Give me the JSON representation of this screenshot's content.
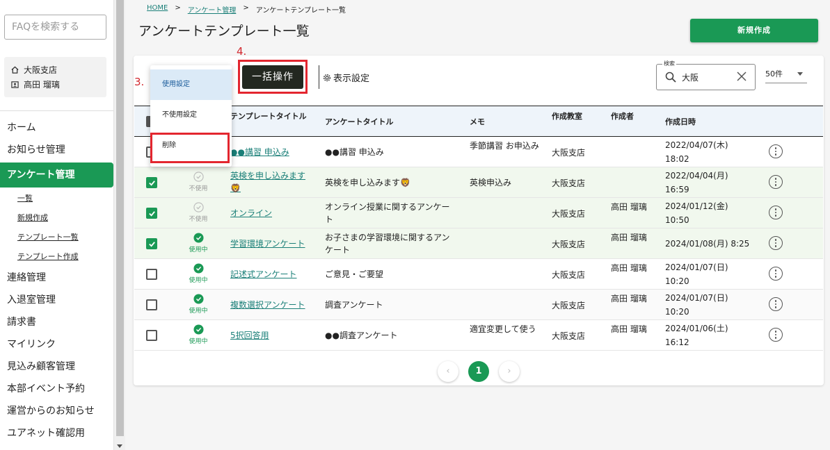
{
  "sidebar": {
    "search_placeholder": "FAQを検索する",
    "school": "大阪支店",
    "user": "高田 瑠璃",
    "nav": {
      "home": "ホーム",
      "news": "お知らせ管理",
      "survey": "アンケート管理",
      "sub_list": "一覧",
      "sub_new": "新規作成",
      "sub_template_list": "テンプレート一覧",
      "sub_template_new": "テンプレート作成",
      "contact": "連絡管理",
      "attendance": "入退室管理",
      "invoice": "請求書",
      "mylink": "マイリンク",
      "prospect": "見込み顧客管理",
      "hq_event": "本部イベント予約",
      "ops_news": "運営からのお知らせ",
      "unet": "ユアネット確認用"
    }
  },
  "breadcrumb": {
    "home": "HOME",
    "sep1": ">",
    "survey": "アンケート管理",
    "sep2": ">",
    "current": "アンケートテンプレート一覧"
  },
  "page_title": "アンケートテンプレート一覧",
  "new_button": "新規作成",
  "toolbar": {
    "bulk_button": "一括操作",
    "display_settings": "表示設定",
    "search_legend": "検索",
    "search_value": "大阪",
    "per_page": "50件"
  },
  "step_labels": {
    "three": "3.",
    "four": "4."
  },
  "dropdown": {
    "enable": "使用設定",
    "disable": "不使用設定",
    "delete": "削除"
  },
  "columns": {
    "template_title": "テンプレートタイトル",
    "survey_title": "アンケートタイトル",
    "memo": "メモ",
    "school": "作成教室",
    "creator": "作成者",
    "created": "作成日時"
  },
  "rows": [
    {
      "checked": false,
      "status": "",
      "title": "●●講習 申込み",
      "survey": "●●講習 申込み",
      "memo": "季節講習 お申込み",
      "school": "大阪支店",
      "creator": "",
      "date": "2022/04/07(木)",
      "time": "18:02"
    },
    {
      "checked": true,
      "status": "不使用",
      "title": "英検を申し込みます🦁",
      "survey": "英検を申し込みます🦁",
      "memo": "英検申込み",
      "school": "大阪支店",
      "creator": "",
      "date": "2022/04/04(月)",
      "time": "16:59"
    },
    {
      "checked": true,
      "status": "不使用",
      "title": "オンライン",
      "survey": "オンライン授業に関するアンケート",
      "memo": "",
      "school": "大阪支店",
      "creator": "高田 瑠璃",
      "date": "2024/01/12(金)",
      "time": "10:50"
    },
    {
      "checked": true,
      "status": "使用中",
      "title": "学習環境アンケート",
      "survey": "お子さまの学習環境に関するアンケート",
      "memo": "",
      "school": "大阪支店",
      "creator": "高田 瑠璃",
      "date": "2024/01/08(月) 8:25",
      "time": ""
    },
    {
      "checked": false,
      "status": "使用中",
      "title": "記述式アンケート",
      "survey": "ご意見・ご要望",
      "memo": "",
      "school": "大阪支店",
      "creator": "高田 瑠璃",
      "date": "2024/01/07(日)",
      "time": "10:20"
    },
    {
      "checked": false,
      "status": "使用中",
      "title": "複数選択アンケート",
      "survey": "調査アンケート",
      "memo": "",
      "school": "大阪支店",
      "creator": "高田 瑠璃",
      "date": "2024/01/07(日)",
      "time": "10:20"
    },
    {
      "checked": false,
      "status": "使用中",
      "title": "5択回答用",
      "survey": "●●調査アンケート",
      "memo": "適宜変更して使う",
      "school": "大阪支店",
      "creator": "高田 瑠璃",
      "date": "2024/01/06(土)",
      "time": "16:12"
    }
  ],
  "pagination": {
    "prev": "‹",
    "current": "1",
    "next": "›"
  },
  "colors": {
    "accent": "#1a9955",
    "link": "#1a7f78",
    "highlight": "#e3262f"
  }
}
